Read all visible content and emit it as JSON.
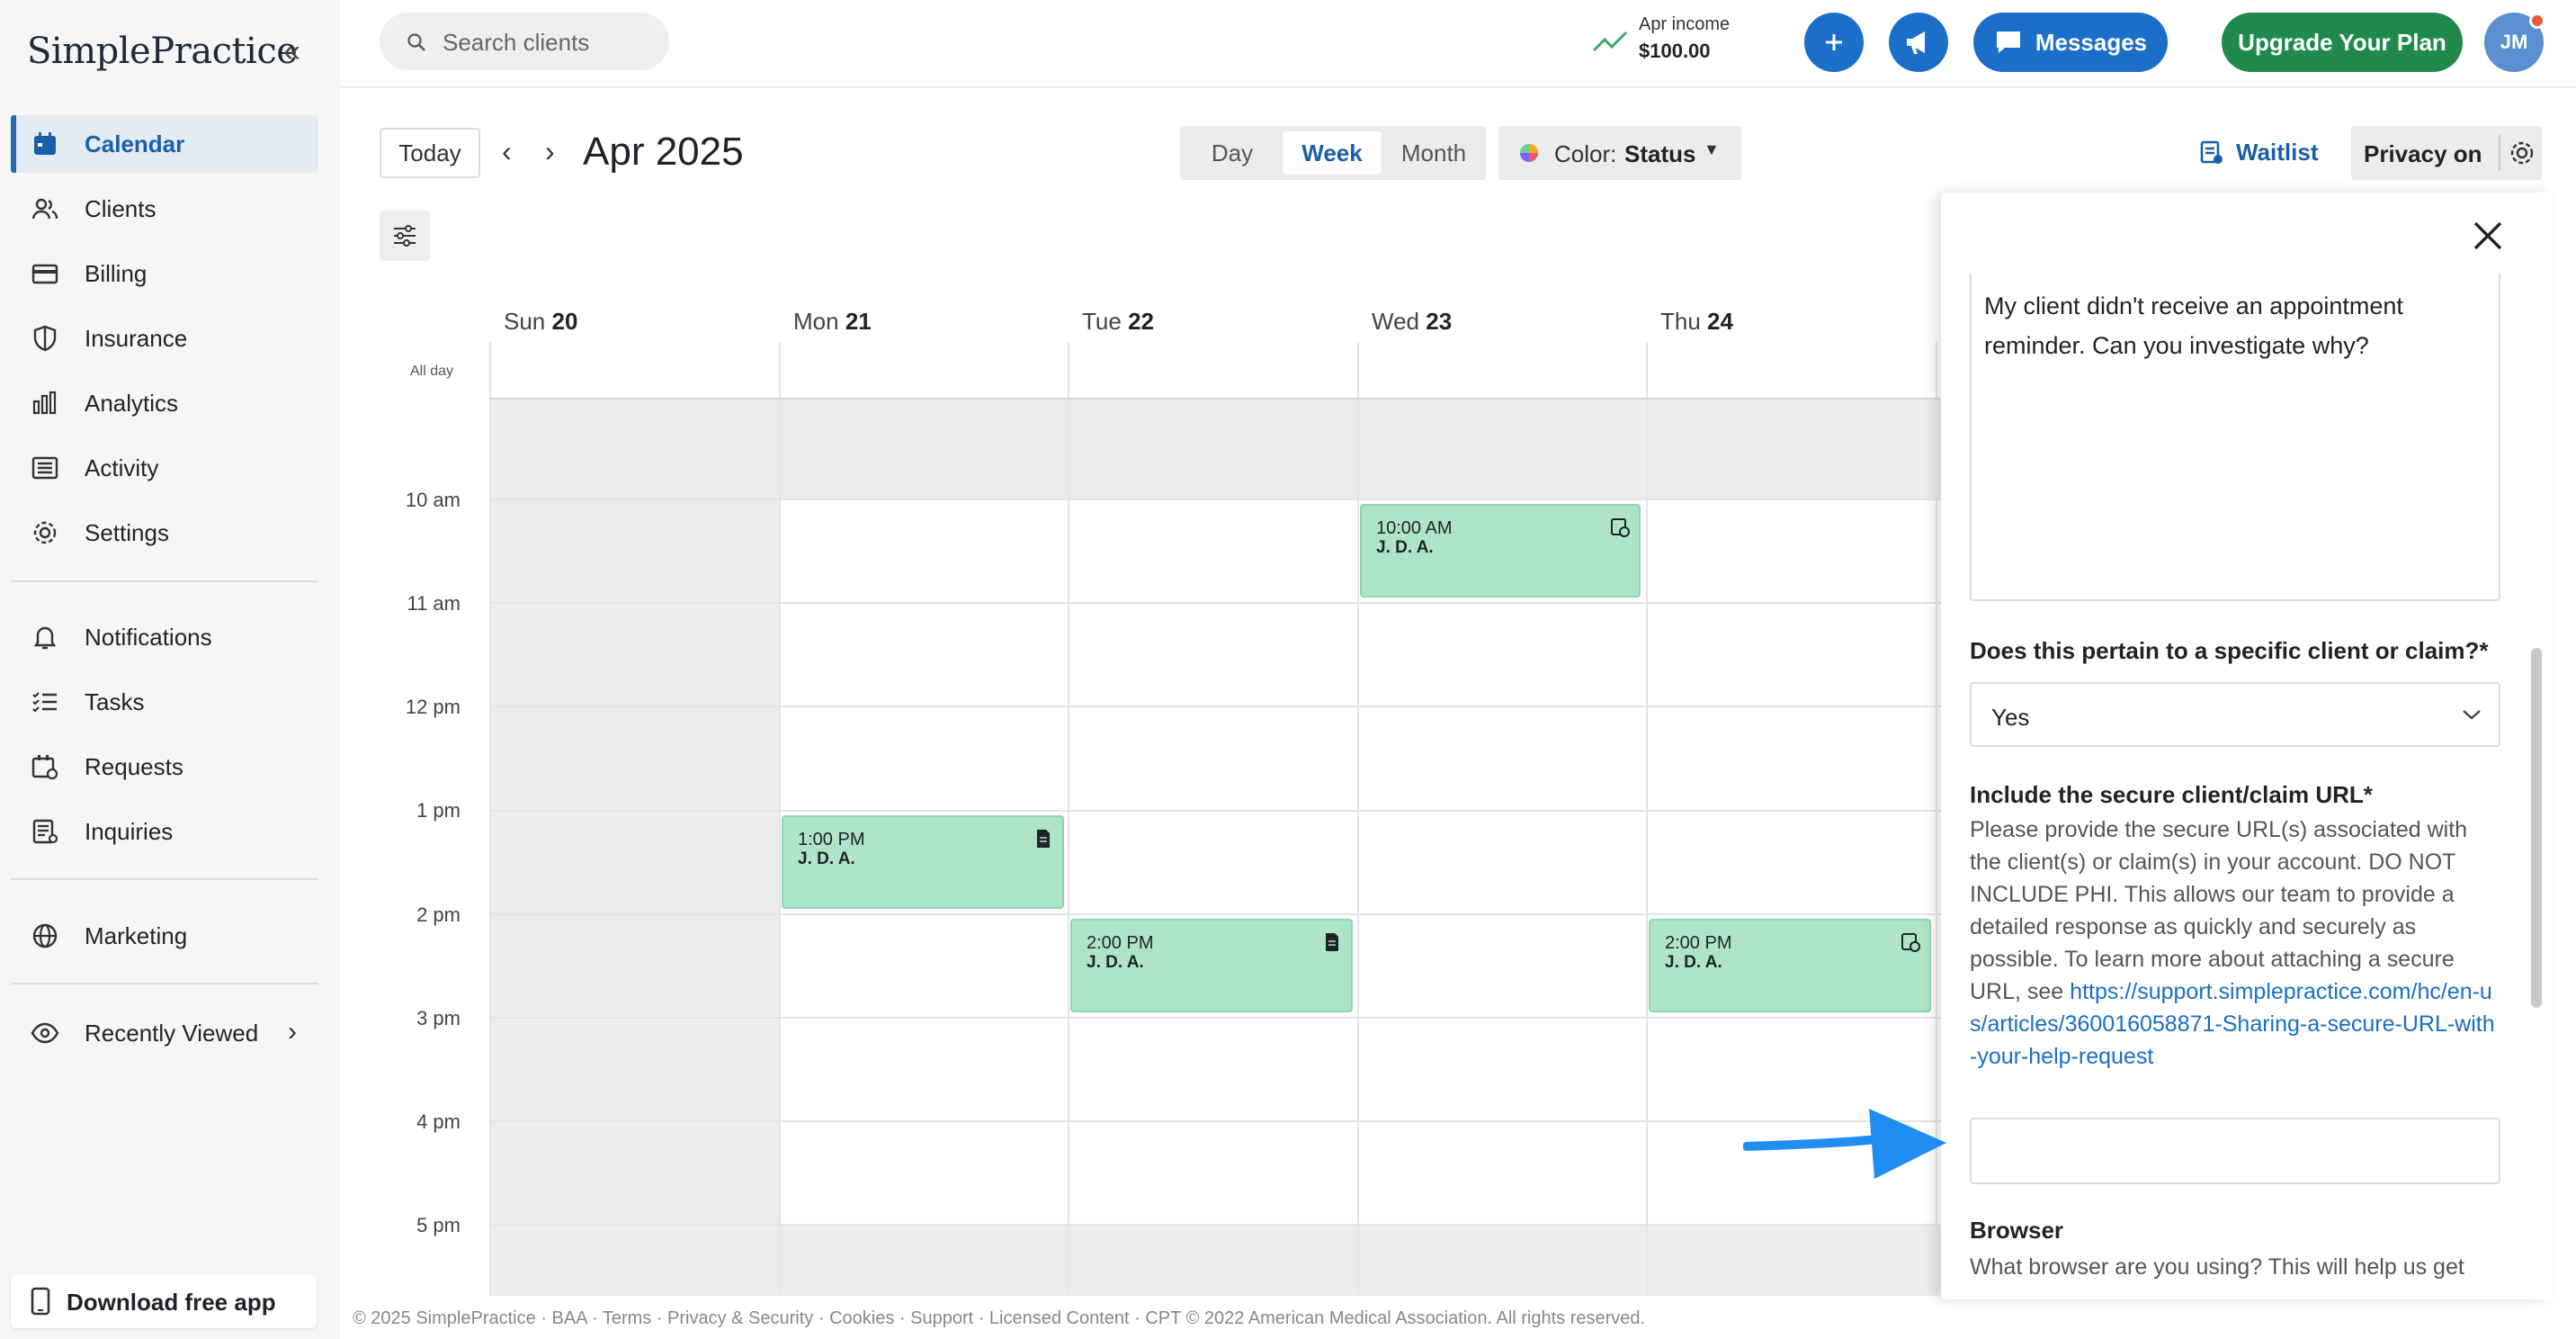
{
  "app": {
    "logo": "SimplePractice"
  },
  "sidebar": {
    "items": [
      {
        "label": "Calendar",
        "icon": "calendar-icon"
      },
      {
        "label": "Clients",
        "icon": "clients-icon"
      },
      {
        "label": "Billing",
        "icon": "billing-icon"
      },
      {
        "label": "Insurance",
        "icon": "shield-icon"
      },
      {
        "label": "Analytics",
        "icon": "analytics-icon"
      },
      {
        "label": "Activity",
        "icon": "activity-icon"
      },
      {
        "label": "Settings",
        "icon": "gear-icon"
      },
      {
        "label": "Notifications",
        "icon": "bell-icon"
      },
      {
        "label": "Tasks",
        "icon": "tasks-icon"
      },
      {
        "label": "Requests",
        "icon": "requests-icon"
      },
      {
        "label": "Inquiries",
        "icon": "inquiries-icon"
      },
      {
        "label": "Marketing",
        "icon": "globe-icon"
      },
      {
        "label": "Recently Viewed",
        "icon": "eye-icon"
      }
    ],
    "download": "Download free app"
  },
  "header": {
    "search_placeholder": "Search clients",
    "income_label": "Apr income",
    "income_value": "$100.00",
    "messages": "Messages",
    "upgrade": "Upgrade Your Plan",
    "avatar": "JM"
  },
  "toolbar": {
    "today": "Today",
    "month": "Apr 2025",
    "views": [
      "Day",
      "Week",
      "Month"
    ],
    "selected_view": "Week",
    "color_label": "Color:",
    "color_value": "Status",
    "waitlist": "Waitlist",
    "privacy": "Privacy on"
  },
  "calendar": {
    "days": [
      {
        "dow": "Sun",
        "num": "20"
      },
      {
        "dow": "Mon",
        "num": "21"
      },
      {
        "dow": "Tue",
        "num": "22"
      },
      {
        "dow": "Wed",
        "num": "23"
      },
      {
        "dow": "Thu",
        "num": "24"
      }
    ],
    "allday": "All day",
    "times": [
      "10 am",
      "11 am",
      "12 pm",
      "1 pm",
      "2 pm",
      "3 pm",
      "4 pm",
      "5 pm"
    ],
    "appointments": [
      {
        "time": "10:00 AM",
        "name": "J. D. A.",
        "day": "Wed 23",
        "icon": "calendar-check-icon"
      },
      {
        "time": "1:00 PM",
        "name": "J. D. A.",
        "day": "Mon 21",
        "icon": "document-icon"
      },
      {
        "time": "2:00 PM",
        "name": "J. D. A.",
        "day": "Tue 22",
        "icon": "document-icon"
      },
      {
        "time": "2:00 PM",
        "name": "J. D. A.",
        "day": "Thu 24",
        "icon": "calendar-check-icon"
      }
    ]
  },
  "footer": "© 2025 SimplePractice · BAA · Terms · Privacy & Security · Cookies · Support · Licensed Content · CPT © 2022 American Medical Association. All rights reserved.",
  "help_panel": {
    "message_text": "My client didn't receive an appointment reminder. Can you investigate why?",
    "question_client": "Does this pertain to a specific client or claim?*",
    "client_answer": "Yes",
    "url_label": "Include the secure client/claim URL*",
    "url_help": "Please provide the secure URL(s) associated with the client(s) or claim(s) in your account. DO NOT INCLUDE PHI. This allows our team to provide a detailed response as quickly and securely as possible. To learn more about attaching a secure URL, see",
    "url_link": "https://support.simplepractice.com/hc/en-us/articles/360016058871-Sharing-a-secure-URL-with-your-help-request",
    "url_value": "",
    "browser_label": "Browser",
    "browser_help": "What browser are you using? This will help us get"
  },
  "colors": {
    "accent": "#1b6fc9",
    "upgrade": "#1f8a4c",
    "appointment": "#aee5c7",
    "annotation_arrow": "#1f8ef0"
  }
}
